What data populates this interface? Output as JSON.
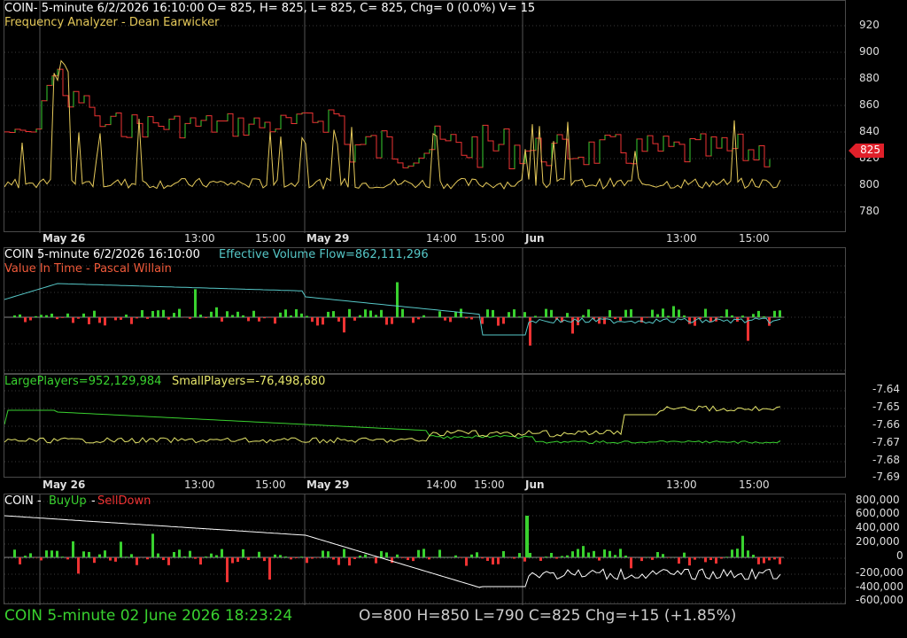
{
  "colors": {
    "up": "#39d12f",
    "down": "#e33",
    "analyzer": "#e5c95a",
    "flow": "#56c7c7",
    "large": "#39d12f",
    "small": "#e5e56a",
    "white": "#ffffff",
    "grid": "#3a3a3a",
    "accent": "#e0202a"
  },
  "price_panel": {
    "header": "COIN- 5-minute 6/2/2026 16:10:00 O= 825, H= 825, L= 825, C= 825, Chg= 0 (0.0%) V= 15",
    "indicator": "Frequency Analyzer - Dean Earwicker",
    "price_tag": "825",
    "y_ticks": [
      "920",
      "900",
      "880",
      "860",
      "840",
      "820",
      "800",
      "780"
    ]
  },
  "x_labels": {
    "may26": "May 26",
    "t1300a": "13:00",
    "t1500a": "15:00",
    "may29": "May 29",
    "t1400": "14:00",
    "t1500b": "15:00",
    "jun": "Jun",
    "t1300b": "13:00",
    "t1500c": "15:00"
  },
  "flow_panel": {
    "header_left": "COIN 5-minute  6/2/2026 16:10:00",
    "header_flow": "Effective Volume Flow=862,111,296",
    "indicator": "Value In Time - Pascal Willain"
  },
  "players_panel": {
    "large": "LargePlayers=952,129,984",
    "small": "SmallPlayers=-76,498,680",
    "y_ticks": [
      "-7.64",
      "-7.65",
      "-7.66",
      "-7.67",
      "-7.68",
      "-7.69"
    ]
  },
  "buy_panel": {
    "prefix": "COIN - ",
    "buy": "BuyUp",
    "dash": "-",
    "sell": "SellDown",
    "y_ticks": [
      "800,000",
      "600,000",
      "400,000",
      "200,000",
      "0",
      "-200,000",
      "-400,000",
      "-600,000"
    ]
  },
  "footer": {
    "left": "COIN  5-minute   02 June 2026 18:23:24",
    "right": "O=800  H=850  L=790  C=825  Chg=+15 (+1.85%)"
  }
}
